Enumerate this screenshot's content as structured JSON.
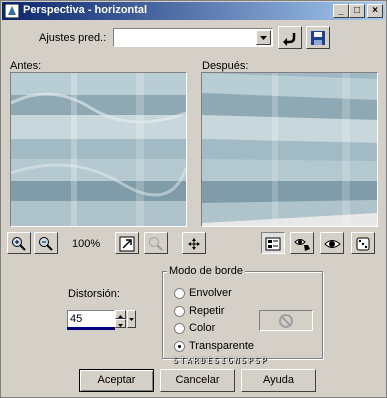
{
  "window": {
    "title": "Perspectiva - horizontal"
  },
  "presets": {
    "label": "Ajustes pred.:",
    "value": ""
  },
  "before_label": "Antes:",
  "after_label": "Después:",
  "zoom_level": "100%",
  "distortion": {
    "label": "Distorsión:",
    "value": "45"
  },
  "edge_mode": {
    "label": "Modo de borde",
    "options": [
      "Envolver",
      "Repetir",
      "Color",
      "Transparente"
    ],
    "selected": "Transparente"
  },
  "watermark": "STARDESIGNSPSP",
  "buttons": {
    "ok": "Aceptar",
    "cancel": "Cancelar",
    "help": "Ayuda"
  }
}
